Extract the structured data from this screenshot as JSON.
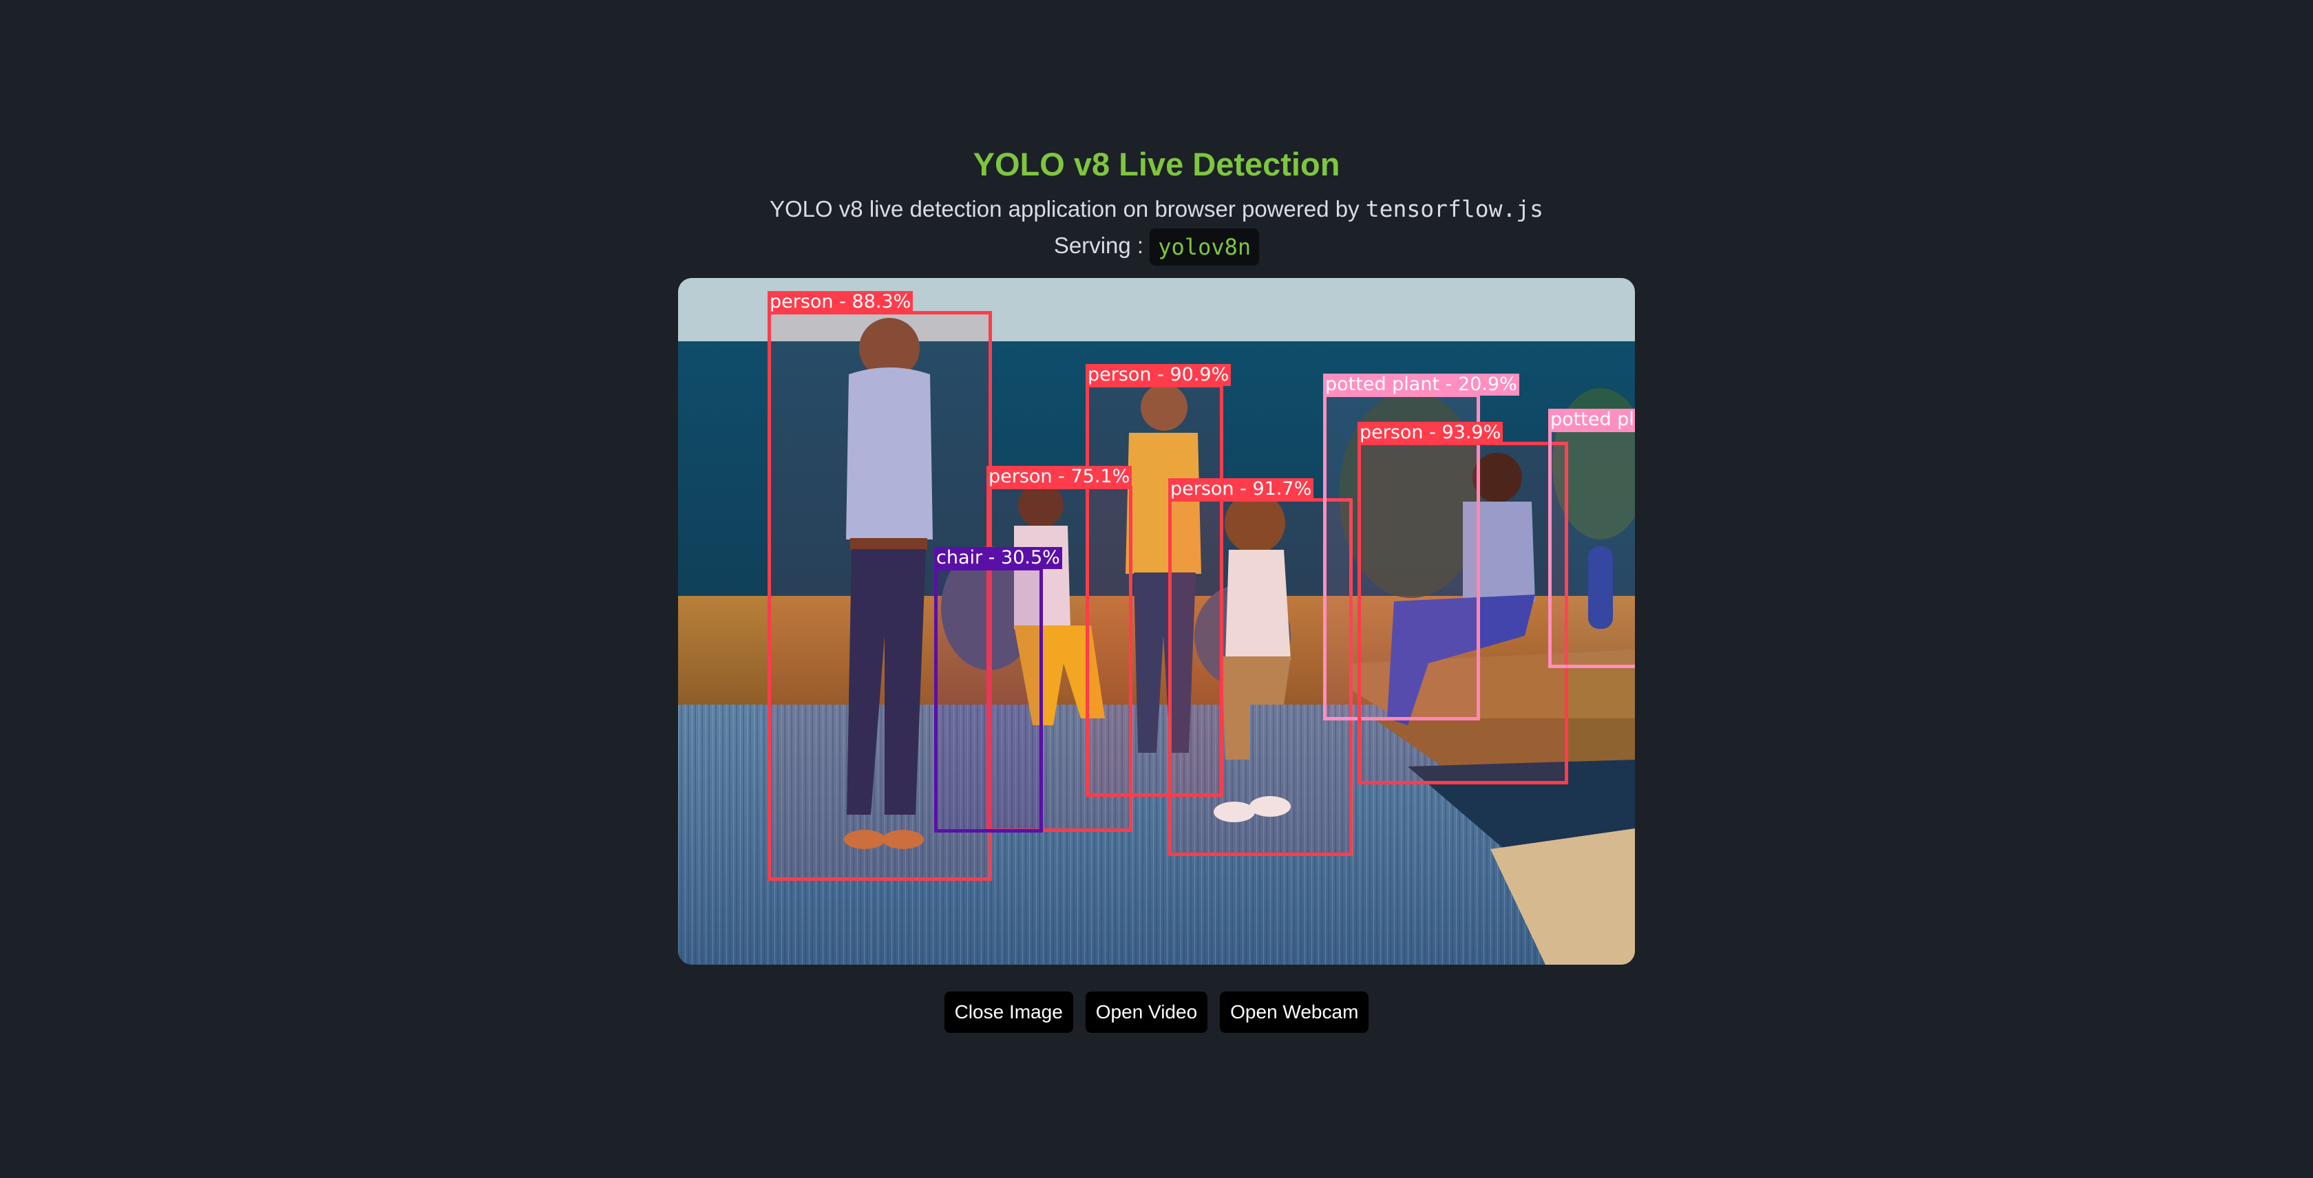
{
  "header": {
    "title": "YOLO v8 Live Detection",
    "subtitle_prefix": "YOLO v8 live detection application on browser powered by ",
    "subtitle_code": "tensorflow.js",
    "serving_label": "Serving : ",
    "model_name": "yolov8n"
  },
  "colors": {
    "background": "#1c2027",
    "title": "#7ec63f",
    "person": "#ff3c4b",
    "potted_plant": "#ff8fc0",
    "chair": "#5a0fa8"
  },
  "detections": [
    {
      "label": "person - 88.3%",
      "class": "person"
    },
    {
      "label": "person - 90.9%",
      "class": "person"
    },
    {
      "label": "person - 75.1%",
      "class": "person"
    },
    {
      "label": "chair - 30.5%",
      "class": "chair"
    },
    {
      "label": "person - 91.7%",
      "class": "person"
    },
    {
      "label": "potted plant - 20.9%",
      "class": "potted plant"
    },
    {
      "label": "person - 93.9%",
      "class": "person"
    },
    {
      "label": "potted plant",
      "class": "potted plant"
    }
  ],
  "controls": {
    "close_image": "Close Image",
    "open_video": "Open Video",
    "open_webcam": "Open Webcam"
  }
}
